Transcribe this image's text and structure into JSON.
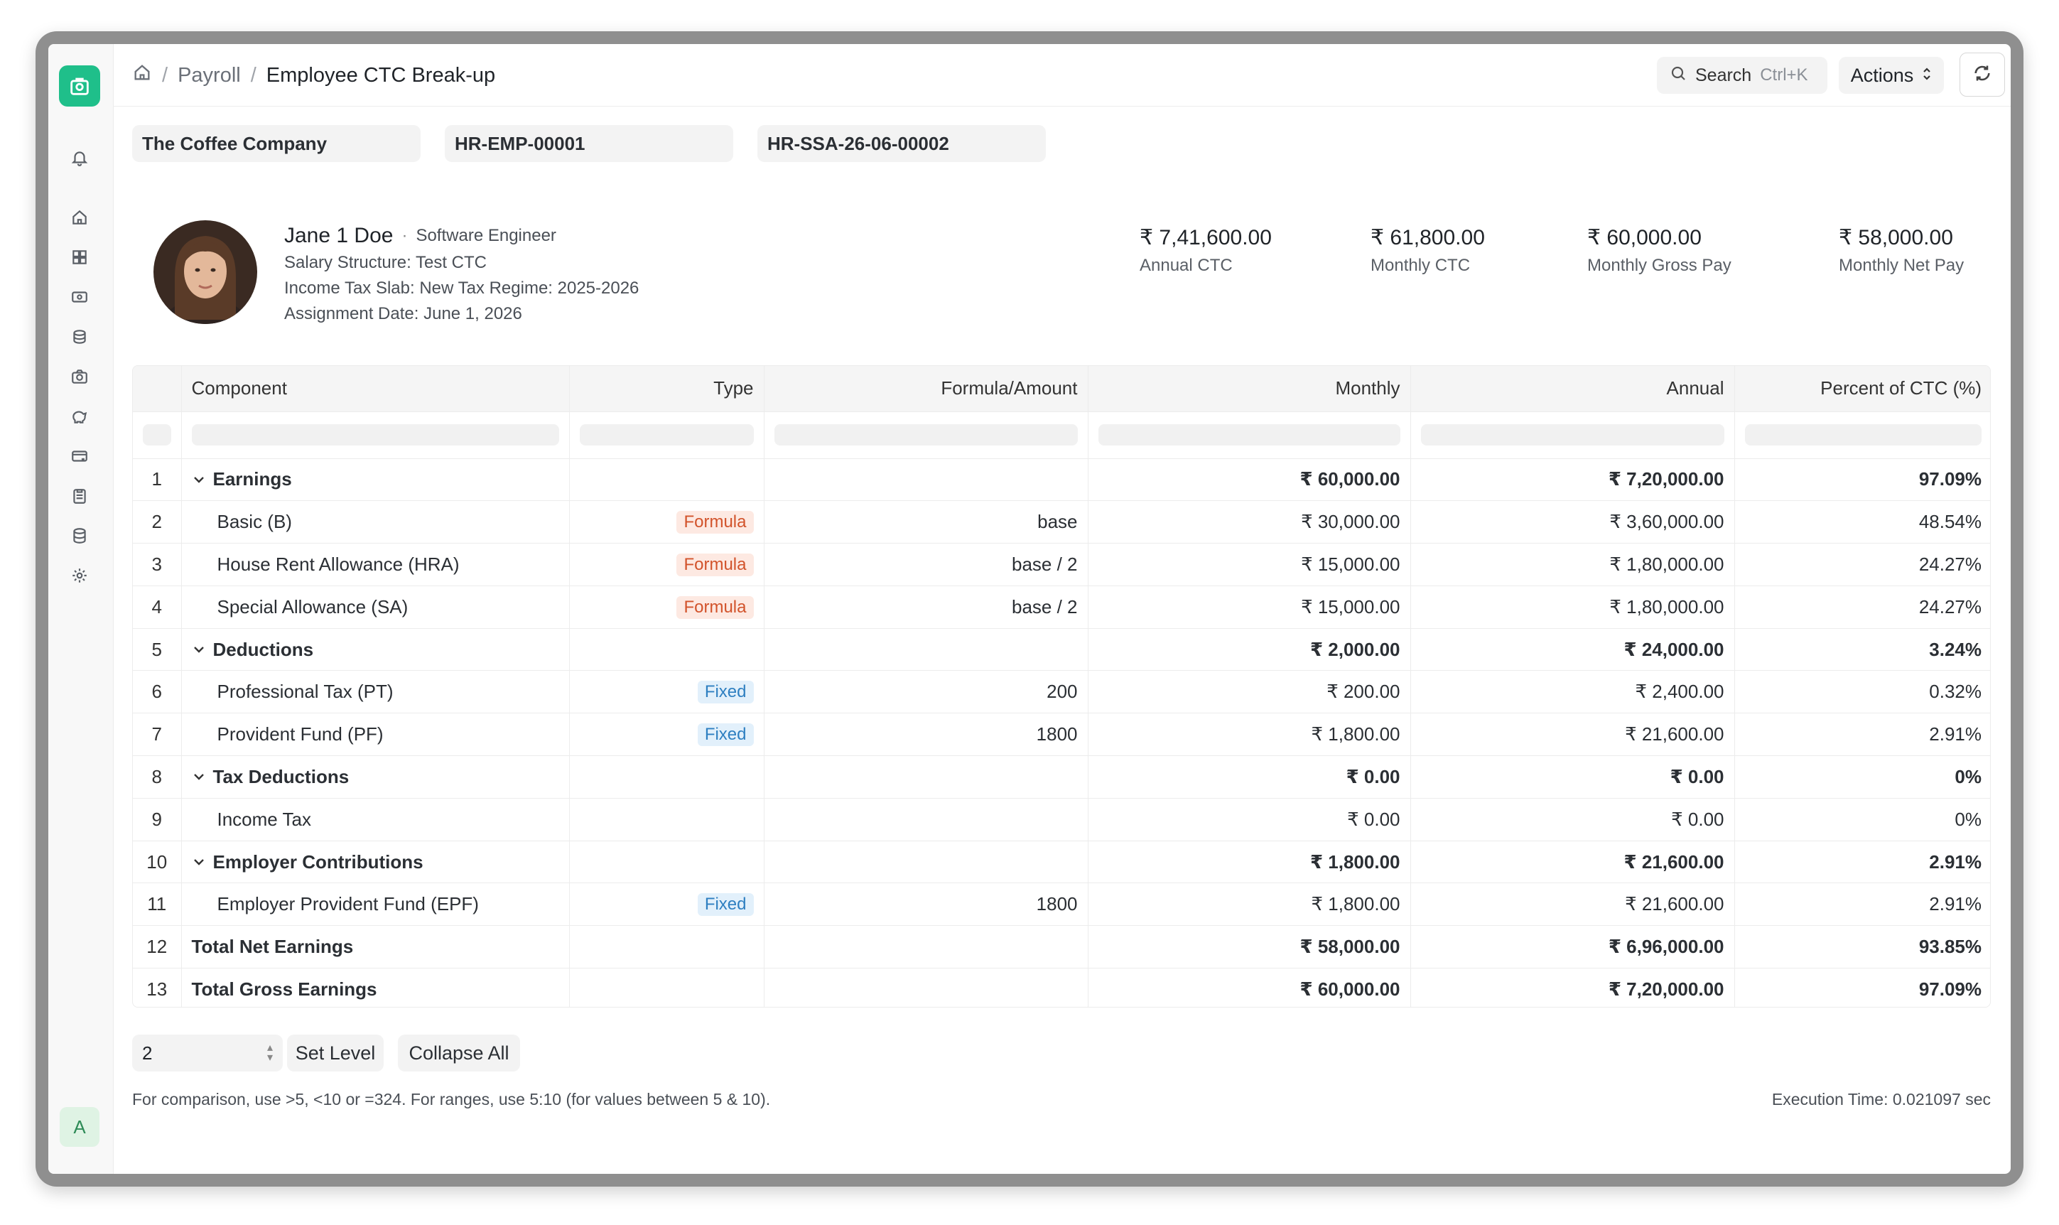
{
  "breadcrumb": {
    "parent": "Payroll",
    "current": "Employee CTC Break-up"
  },
  "header": {
    "search_label": "Search",
    "search_shortcut": "Ctrl+K",
    "actions_label": "Actions",
    "more_label": "···"
  },
  "filters": {
    "company": "The Coffee Company",
    "employee": "HR-EMP-00001",
    "assignment": "HR-SSA-26-06-00002"
  },
  "employee": {
    "name": "Jane 1 Doe",
    "designation": "Software Engineer",
    "salary_structure": "Salary Structure: Test CTC",
    "tax_slab": "Income Tax Slab: New Tax Regime: 2025-2026",
    "assignment_date": "Assignment Date: June 1, 2026"
  },
  "kpis": [
    {
      "value": "₹ 7,41,600.00",
      "label": "Annual CTC"
    },
    {
      "value": "₹ 61,800.00",
      "label": "Monthly CTC"
    },
    {
      "value": "₹ 60,000.00",
      "label": "Monthly Gross Pay"
    },
    {
      "value": "₹ 58,000.00",
      "label": "Monthly Net Pay"
    }
  ],
  "table": {
    "columns": [
      "Component",
      "Type",
      "Formula/Amount",
      "Monthly",
      "Annual",
      "Percent of CTC (%)"
    ],
    "rows": [
      {
        "idx": "1",
        "component": "Earnings",
        "type": "",
        "formula": "",
        "monthly": "₹ 60,000.00",
        "annual": "₹ 7,20,000.00",
        "percent": "97.09%"
      },
      {
        "idx": "2",
        "component": "Basic (B)",
        "type": "Formula",
        "formula": "base",
        "monthly": "₹ 30,000.00",
        "annual": "₹ 3,60,000.00",
        "percent": "48.54%"
      },
      {
        "idx": "3",
        "component": "House Rent Allowance (HRA)",
        "type": "Formula",
        "formula": "base / 2",
        "monthly": "₹ 15,000.00",
        "annual": "₹ 1,80,000.00",
        "percent": "24.27%"
      },
      {
        "idx": "4",
        "component": "Special Allowance (SA)",
        "type": "Formula",
        "formula": "base / 2",
        "monthly": "₹ 15,000.00",
        "annual": "₹ 1,80,000.00",
        "percent": "24.27%"
      },
      {
        "idx": "5",
        "component": "Deductions",
        "type": "",
        "formula": "",
        "monthly": "₹ 2,000.00",
        "annual": "₹ 24,000.00",
        "percent": "3.24%"
      },
      {
        "idx": "6",
        "component": "Professional Tax (PT)",
        "type": "Fixed",
        "formula": "200",
        "monthly": "₹ 200.00",
        "annual": "₹ 2,400.00",
        "percent": "0.32%"
      },
      {
        "idx": "7",
        "component": "Provident Fund (PF)",
        "type": "Fixed",
        "formula": "1800",
        "monthly": "₹ 1,800.00",
        "annual": "₹ 21,600.00",
        "percent": "2.91%"
      },
      {
        "idx": "8",
        "component": "Tax Deductions",
        "type": "",
        "formula": "",
        "monthly": "₹ 0.00",
        "annual": "₹ 0.00",
        "percent": "0%"
      },
      {
        "idx": "9",
        "component": "Income Tax",
        "type": "",
        "formula": "",
        "monthly": "₹ 0.00",
        "annual": "₹ 0.00",
        "percent": "0%"
      },
      {
        "idx": "10",
        "component": "Employer Contributions",
        "type": "",
        "formula": "",
        "monthly": "₹ 1,800.00",
        "annual": "₹ 21,600.00",
        "percent": "2.91%"
      },
      {
        "idx": "11",
        "component": "Employer Provident Fund (EPF)",
        "type": "Fixed",
        "formula": "1800",
        "monthly": "₹ 1,800.00",
        "annual": "₹ 21,600.00",
        "percent": "2.91%"
      },
      {
        "idx": "12",
        "component": "Total Net Earnings",
        "type": "",
        "formula": "",
        "monthly": "₹ 58,000.00",
        "annual": "₹ 6,96,000.00",
        "percent": "93.85%"
      },
      {
        "idx": "13",
        "component": "Total Gross Earnings",
        "type": "",
        "formula": "",
        "monthly": "₹ 60,000.00",
        "annual": "₹ 7,20,000.00",
        "percent": "97.09%"
      }
    ]
  },
  "footer": {
    "level_value": "2",
    "set_level_label": "Set Level",
    "collapse_all_label": "Collapse All",
    "hint": "For comparison, use >5, <10 or =324. For ranges, use 5:10 (for values between 5 & 10).",
    "execution_time": "Execution Time: 0.021097 sec"
  },
  "sidebar": {
    "avatar_initial": "A"
  },
  "colors": {
    "brand": "#1fbf8a",
    "formula_badge": "#d2532b",
    "fixed_badge": "#2e7fc1"
  }
}
